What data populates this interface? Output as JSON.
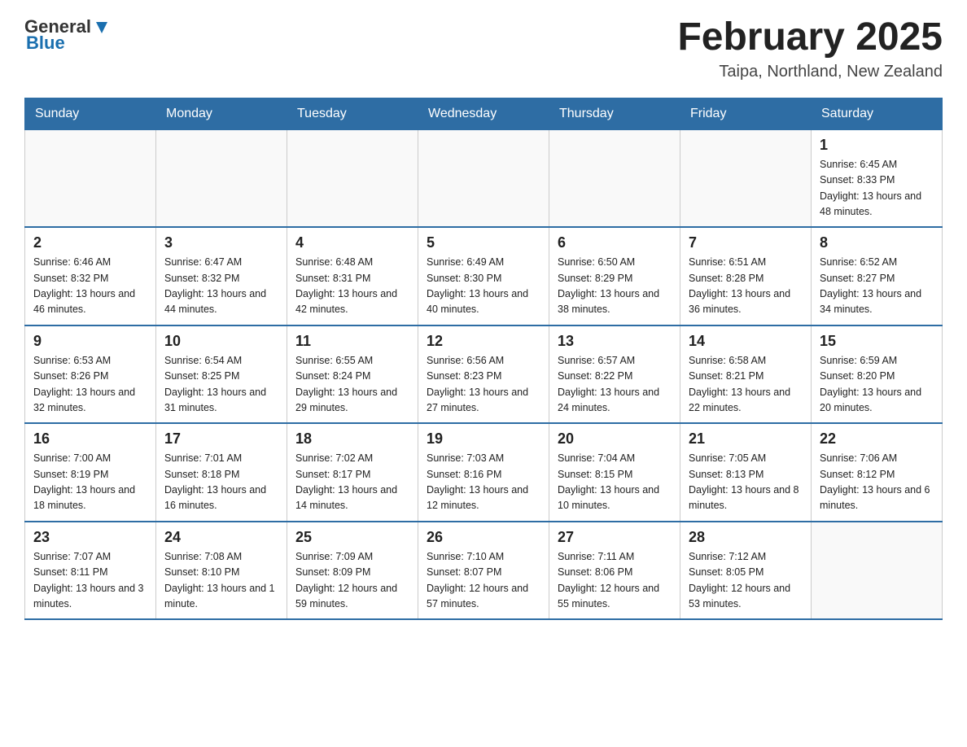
{
  "header": {
    "logo_general": "General",
    "logo_blue": "Blue",
    "title": "February 2025",
    "subtitle": "Taipa, Northland, New Zealand"
  },
  "weekdays": [
    "Sunday",
    "Monday",
    "Tuesday",
    "Wednesday",
    "Thursday",
    "Friday",
    "Saturday"
  ],
  "weeks": [
    [
      {
        "day": "",
        "sunrise": "",
        "sunset": "",
        "daylight": ""
      },
      {
        "day": "",
        "sunrise": "",
        "sunset": "",
        "daylight": ""
      },
      {
        "day": "",
        "sunrise": "",
        "sunset": "",
        "daylight": ""
      },
      {
        "day": "",
        "sunrise": "",
        "sunset": "",
        "daylight": ""
      },
      {
        "day": "",
        "sunrise": "",
        "sunset": "",
        "daylight": ""
      },
      {
        "day": "",
        "sunrise": "",
        "sunset": "",
        "daylight": ""
      },
      {
        "day": "1",
        "sunrise": "Sunrise: 6:45 AM",
        "sunset": "Sunset: 8:33 PM",
        "daylight": "Daylight: 13 hours and 48 minutes."
      }
    ],
    [
      {
        "day": "2",
        "sunrise": "Sunrise: 6:46 AM",
        "sunset": "Sunset: 8:32 PM",
        "daylight": "Daylight: 13 hours and 46 minutes."
      },
      {
        "day": "3",
        "sunrise": "Sunrise: 6:47 AM",
        "sunset": "Sunset: 8:32 PM",
        "daylight": "Daylight: 13 hours and 44 minutes."
      },
      {
        "day": "4",
        "sunrise": "Sunrise: 6:48 AM",
        "sunset": "Sunset: 8:31 PM",
        "daylight": "Daylight: 13 hours and 42 minutes."
      },
      {
        "day": "5",
        "sunrise": "Sunrise: 6:49 AM",
        "sunset": "Sunset: 8:30 PM",
        "daylight": "Daylight: 13 hours and 40 minutes."
      },
      {
        "day": "6",
        "sunrise": "Sunrise: 6:50 AM",
        "sunset": "Sunset: 8:29 PM",
        "daylight": "Daylight: 13 hours and 38 minutes."
      },
      {
        "day": "7",
        "sunrise": "Sunrise: 6:51 AM",
        "sunset": "Sunset: 8:28 PM",
        "daylight": "Daylight: 13 hours and 36 minutes."
      },
      {
        "day": "8",
        "sunrise": "Sunrise: 6:52 AM",
        "sunset": "Sunset: 8:27 PM",
        "daylight": "Daylight: 13 hours and 34 minutes."
      }
    ],
    [
      {
        "day": "9",
        "sunrise": "Sunrise: 6:53 AM",
        "sunset": "Sunset: 8:26 PM",
        "daylight": "Daylight: 13 hours and 32 minutes."
      },
      {
        "day": "10",
        "sunrise": "Sunrise: 6:54 AM",
        "sunset": "Sunset: 8:25 PM",
        "daylight": "Daylight: 13 hours and 31 minutes."
      },
      {
        "day": "11",
        "sunrise": "Sunrise: 6:55 AM",
        "sunset": "Sunset: 8:24 PM",
        "daylight": "Daylight: 13 hours and 29 minutes."
      },
      {
        "day": "12",
        "sunrise": "Sunrise: 6:56 AM",
        "sunset": "Sunset: 8:23 PM",
        "daylight": "Daylight: 13 hours and 27 minutes."
      },
      {
        "day": "13",
        "sunrise": "Sunrise: 6:57 AM",
        "sunset": "Sunset: 8:22 PM",
        "daylight": "Daylight: 13 hours and 24 minutes."
      },
      {
        "day": "14",
        "sunrise": "Sunrise: 6:58 AM",
        "sunset": "Sunset: 8:21 PM",
        "daylight": "Daylight: 13 hours and 22 minutes."
      },
      {
        "day": "15",
        "sunrise": "Sunrise: 6:59 AM",
        "sunset": "Sunset: 8:20 PM",
        "daylight": "Daylight: 13 hours and 20 minutes."
      }
    ],
    [
      {
        "day": "16",
        "sunrise": "Sunrise: 7:00 AM",
        "sunset": "Sunset: 8:19 PM",
        "daylight": "Daylight: 13 hours and 18 minutes."
      },
      {
        "day": "17",
        "sunrise": "Sunrise: 7:01 AM",
        "sunset": "Sunset: 8:18 PM",
        "daylight": "Daylight: 13 hours and 16 minutes."
      },
      {
        "day": "18",
        "sunrise": "Sunrise: 7:02 AM",
        "sunset": "Sunset: 8:17 PM",
        "daylight": "Daylight: 13 hours and 14 minutes."
      },
      {
        "day": "19",
        "sunrise": "Sunrise: 7:03 AM",
        "sunset": "Sunset: 8:16 PM",
        "daylight": "Daylight: 13 hours and 12 minutes."
      },
      {
        "day": "20",
        "sunrise": "Sunrise: 7:04 AM",
        "sunset": "Sunset: 8:15 PM",
        "daylight": "Daylight: 13 hours and 10 minutes."
      },
      {
        "day": "21",
        "sunrise": "Sunrise: 7:05 AM",
        "sunset": "Sunset: 8:13 PM",
        "daylight": "Daylight: 13 hours and 8 minutes."
      },
      {
        "day": "22",
        "sunrise": "Sunrise: 7:06 AM",
        "sunset": "Sunset: 8:12 PM",
        "daylight": "Daylight: 13 hours and 6 minutes."
      }
    ],
    [
      {
        "day": "23",
        "sunrise": "Sunrise: 7:07 AM",
        "sunset": "Sunset: 8:11 PM",
        "daylight": "Daylight: 13 hours and 3 minutes."
      },
      {
        "day": "24",
        "sunrise": "Sunrise: 7:08 AM",
        "sunset": "Sunset: 8:10 PM",
        "daylight": "Daylight: 13 hours and 1 minute."
      },
      {
        "day": "25",
        "sunrise": "Sunrise: 7:09 AM",
        "sunset": "Sunset: 8:09 PM",
        "daylight": "Daylight: 12 hours and 59 minutes."
      },
      {
        "day": "26",
        "sunrise": "Sunrise: 7:10 AM",
        "sunset": "Sunset: 8:07 PM",
        "daylight": "Daylight: 12 hours and 57 minutes."
      },
      {
        "day": "27",
        "sunrise": "Sunrise: 7:11 AM",
        "sunset": "Sunset: 8:06 PM",
        "daylight": "Daylight: 12 hours and 55 minutes."
      },
      {
        "day": "28",
        "sunrise": "Sunrise: 7:12 AM",
        "sunset": "Sunset: 8:05 PM",
        "daylight": "Daylight: 12 hours and 53 minutes."
      },
      {
        "day": "",
        "sunrise": "",
        "sunset": "",
        "daylight": ""
      }
    ]
  ]
}
